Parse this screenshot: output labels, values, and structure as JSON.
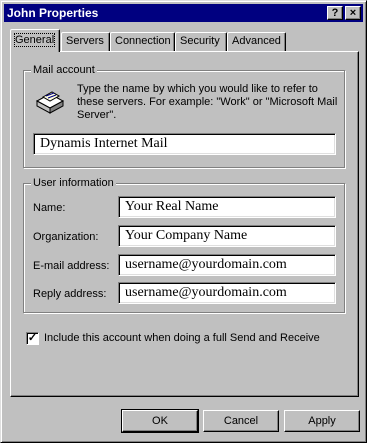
{
  "window": {
    "title": "John  Properties",
    "help_glyph": "?",
    "close_glyph": "×"
  },
  "tabs": [
    {
      "label": "General",
      "active": true
    },
    {
      "label": "Servers"
    },
    {
      "label": "Connection"
    },
    {
      "label": "Security"
    },
    {
      "label": "Advanced"
    }
  ],
  "mail_account": {
    "group_label": "Mail account",
    "description": "Type the name by which you would like to refer to these servers.  For example: \"Work\" or \"Microsoft Mail Server\".",
    "icon": "mail-envelope-icon",
    "account_name": "Dynamis Internet Mail"
  },
  "user_info": {
    "group_label": "User information",
    "fields": [
      {
        "label": "Name:",
        "value": "Your Real Name"
      },
      {
        "label": "Organization:",
        "value": "Your Company Name"
      },
      {
        "label": "E-mail address:",
        "value": "username@yourdomain.com"
      },
      {
        "label": "Reply address:",
        "value": "username@yourdomain.com"
      }
    ]
  },
  "include_checkbox": {
    "checked": true,
    "mark": "✓",
    "label": "Include this account when doing a full Send and Receive"
  },
  "buttons": {
    "ok": "OK",
    "cancel": "Cancel",
    "apply": "Apply"
  }
}
